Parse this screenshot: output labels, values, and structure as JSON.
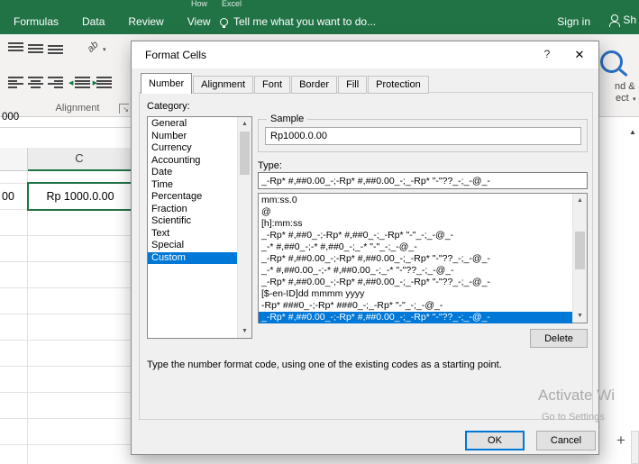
{
  "titlebar": {
    "title_left": "How",
    "title_right": "Excel"
  },
  "ribbon": {
    "tabs": [
      "Formulas",
      "Data",
      "Review",
      "View"
    ],
    "tell_me": "Tell me what you want to do...",
    "sign_in": "Sign in",
    "share_partial": "Sh",
    "group_label": "Alignment",
    "find_select_line1": "nd &",
    "find_select_line2": "ect"
  },
  "sheet": {
    "name_box_partial": "000",
    "column_header": "C",
    "cell_partial": "00",
    "active_cell_value": "Rp 1000.0.00"
  },
  "dialog": {
    "title": "Format Cells",
    "tabs": [
      "Number",
      "Alignment",
      "Font",
      "Border",
      "Fill",
      "Protection"
    ],
    "active_tab": "Number",
    "category_label": "Category:",
    "categories": [
      "General",
      "Number",
      "Currency",
      "Accounting",
      "Date",
      "Time",
      "Percentage",
      "Fraction",
      "Scientific",
      "Text",
      "Special",
      "Custom"
    ],
    "selected_category": "Custom",
    "sample_label": "Sample",
    "sample_value": "Rp1000.0.00",
    "type_label": "Type:",
    "type_value": "_-Rp* #,##0.00_-;-Rp* #,##0.00_-;_-Rp* \"-\"??_-;_-@_-",
    "format_codes": [
      "mm:ss.0",
      "@",
      "[h]:mm:ss",
      "_-Rp* #,##0_-;-Rp* #,##0_-;_-Rp* \"-\"_-;_-@_-",
      "_-* #,##0_-;-* #,##0_-;_-* \"-\"_-;_-@_-",
      "_-Rp* #,##0.00_-;-Rp* #,##0.00_-;_-Rp* \"-\"??_-;_-@_-",
      "_-* #,##0.00_-;-* #,##0.00_-;_-* \"-\"??_-;_-@_-",
      "_-Rp* #,##0.00_-;-Rp* #,##0.00_-;_-Rp* \"-\"??_-;_-@_-",
      "[$-en-ID]dd mmmm yyyy",
      "-Rp* ###0_-;-Rp* ###0_-;_-Rp* \"-\"_-;_-@_-",
      "_-Rp* #,##0.00_-;-Rp* #,##0.00_-;_-Rp* \"-\"??_-;_-@_-"
    ],
    "selected_code_index": 10,
    "delete_button": "Delete",
    "description": "Type the number format code, using one of the existing codes as a starting point.",
    "ok_button": "OK",
    "cancel_button": "Cancel"
  },
  "watermark": {
    "line1": "Activate Wi",
    "line2": "Go to Settings"
  },
  "colors": {
    "excel_green": "#217346",
    "selection_blue": "#0078d7"
  },
  "icons": {
    "close": "✕",
    "help": "?",
    "dropdown": "▾",
    "scroll_up": "▲",
    "scroll_down": "▼",
    "indent_left": "◀",
    "indent_right": "▶",
    "orientation_text": "ab",
    "launcher_arrow": "↘",
    "plus": "+"
  }
}
